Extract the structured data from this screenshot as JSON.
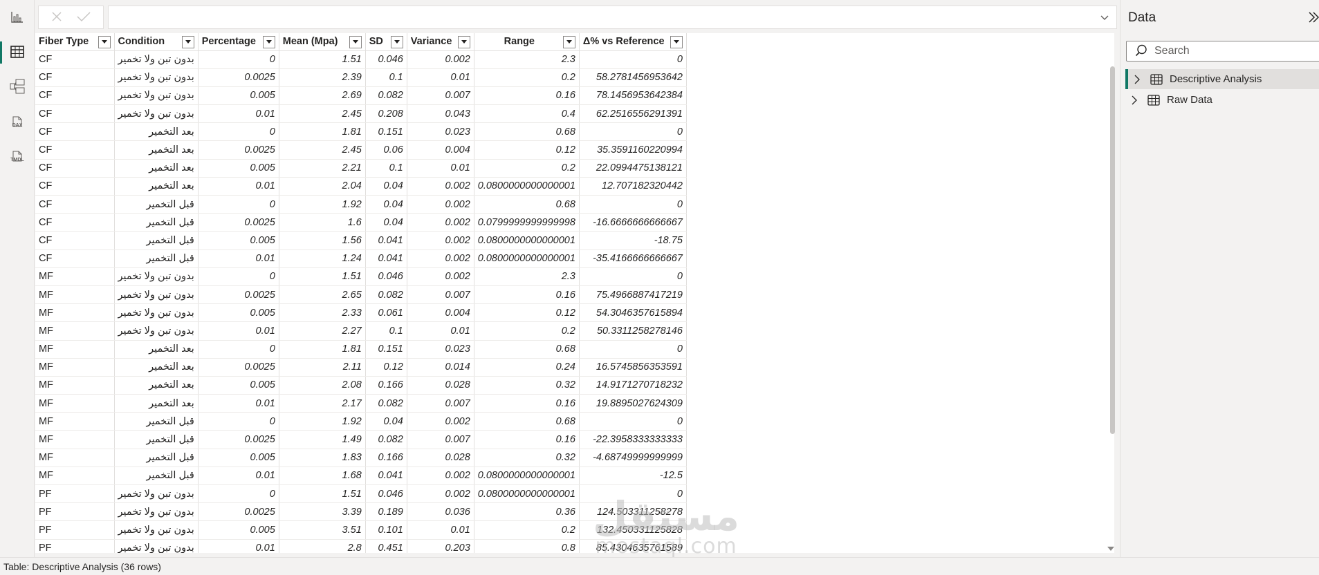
{
  "formula_bar": {
    "cancel_icon": "close-icon",
    "commit_icon": "check-icon",
    "value": "",
    "expand_icon": "chevron-down-icon"
  },
  "rail": [
    {
      "name": "report-view",
      "icon": "bar-chart-icon",
      "label": ""
    },
    {
      "name": "table-view",
      "icon": "table-icon",
      "label": "",
      "active": true
    },
    {
      "name": "model-view",
      "icon": "model-icon",
      "label": ""
    },
    {
      "name": "dax-query-view",
      "icon": "dax-icon",
      "label": "DAX"
    },
    {
      "name": "tmdl-view",
      "icon": "tmdl-icon",
      "label": "TMDL"
    }
  ],
  "table": {
    "columns": [
      "Fiber Type",
      "Condition",
      "Percentage",
      "Mean (Mpa)",
      "SD",
      "Variance",
      "Range",
      "Δ% vs Reference"
    ],
    "rows": [
      [
        "CF",
        "بدون تبن ولا تخمير",
        "0",
        "1.51",
        "0.046",
        "0.002",
        "2.3",
        "0"
      ],
      [
        "CF",
        "بدون تبن ولا تخمير",
        "0.0025",
        "2.39",
        "0.1",
        "0.01",
        "0.2",
        "58.2781456953642"
      ],
      [
        "CF",
        "بدون تبن ولا تخمير",
        "0.005",
        "2.69",
        "0.082",
        "0.007",
        "0.16",
        "78.1456953642384"
      ],
      [
        "CF",
        "بدون تبن ولا تخمير",
        "0.01",
        "2.45",
        "0.208",
        "0.043",
        "0.4",
        "62.2516556291391"
      ],
      [
        "CF",
        "بعد التخمير",
        "0",
        "1.81",
        "0.151",
        "0.023",
        "0.68",
        "0"
      ],
      [
        "CF",
        "بعد التخمير",
        "0.0025",
        "2.45",
        "0.06",
        "0.004",
        "0.12",
        "35.3591160220994"
      ],
      [
        "CF",
        "بعد التخمير",
        "0.005",
        "2.21",
        "0.1",
        "0.01",
        "0.2",
        "22.0994475138121"
      ],
      [
        "CF",
        "بعد التخمير",
        "0.01",
        "2.04",
        "0.04",
        "0.002",
        "0.0800000000000001",
        "12.707182320442"
      ],
      [
        "CF",
        "قبل التخمير",
        "0",
        "1.92",
        "0.04",
        "0.002",
        "0.68",
        "0"
      ],
      [
        "CF",
        "قبل التخمير",
        "0.0025",
        "1.6",
        "0.04",
        "0.002",
        "0.0799999999999998",
        "-16.6666666666667"
      ],
      [
        "CF",
        "قبل التخمير",
        "0.005",
        "1.56",
        "0.041",
        "0.002",
        "0.0800000000000001",
        "-18.75"
      ],
      [
        "CF",
        "قبل التخمير",
        "0.01",
        "1.24",
        "0.041",
        "0.002",
        "0.0800000000000001",
        "-35.4166666666667"
      ],
      [
        "MF",
        "بدون تبن ولا تخمير",
        "0",
        "1.51",
        "0.046",
        "0.002",
        "2.3",
        "0"
      ],
      [
        "MF",
        "بدون تبن ولا تخمير",
        "0.0025",
        "2.65",
        "0.082",
        "0.007",
        "0.16",
        "75.4966887417219"
      ],
      [
        "MF",
        "بدون تبن ولا تخمير",
        "0.005",
        "2.33",
        "0.061",
        "0.004",
        "0.12",
        "54.3046357615894"
      ],
      [
        "MF",
        "بدون تبن ولا تخمير",
        "0.01",
        "2.27",
        "0.1",
        "0.01",
        "0.2",
        "50.3311258278146"
      ],
      [
        "MF",
        "بعد التخمير",
        "0",
        "1.81",
        "0.151",
        "0.023",
        "0.68",
        "0"
      ],
      [
        "MF",
        "بعد التخمير",
        "0.0025",
        "2.11",
        "0.12",
        "0.014",
        "0.24",
        "16.5745856353591"
      ],
      [
        "MF",
        "بعد التخمير",
        "0.005",
        "2.08",
        "0.166",
        "0.028",
        "0.32",
        "14.9171270718232"
      ],
      [
        "MF",
        "بعد التخمير",
        "0.01",
        "2.17",
        "0.082",
        "0.007",
        "0.16",
        "19.8895027624309"
      ],
      [
        "MF",
        "قبل التخمير",
        "0",
        "1.92",
        "0.04",
        "0.002",
        "0.68",
        "0"
      ],
      [
        "MF",
        "قبل التخمير",
        "0.0025",
        "1.49",
        "0.082",
        "0.007",
        "0.16",
        "-22.3958333333333"
      ],
      [
        "MF",
        "قبل التخمير",
        "0.005",
        "1.83",
        "0.166",
        "0.028",
        "0.32",
        "-4.68749999999999"
      ],
      [
        "MF",
        "قبل التخمير",
        "0.01",
        "1.68",
        "0.041",
        "0.002",
        "0.0800000000000001",
        "-12.5"
      ],
      [
        "PF",
        "بدون تبن ولا تخمير",
        "0",
        "1.51",
        "0.046",
        "0.002",
        "0.0800000000000001",
        "0"
      ],
      [
        "PF",
        "بدون تبن ولا تخمير",
        "0.0025",
        "3.39",
        "0.189",
        "0.036",
        "0.36",
        "124.503311258278"
      ],
      [
        "PF",
        "بدون تبن ولا تخمير",
        "0.005",
        "3.51",
        "0.101",
        "0.01",
        "0.2",
        "132.450331125828"
      ],
      [
        "PF",
        "بدون تبن ولا تخمير",
        "0.01",
        "2.8",
        "0.451",
        "0.203",
        "0.8",
        "85.4304635761589"
      ]
    ]
  },
  "data_pane": {
    "title": "Data",
    "collapse_icon": "double-chevron-right-icon",
    "search_placeholder": "Search",
    "tables": [
      {
        "label": "Descriptive Analysis",
        "selected": true
      },
      {
        "label": "Raw Data",
        "selected": false
      }
    ]
  },
  "status_bar": {
    "text": "Table: Descriptive Analysis (36 rows)"
  },
  "watermark": {
    "line1": "مستقل",
    "line2": "mostaql.com"
  },
  "colors": {
    "accent": "#117865",
    "background": "#f3f2f1",
    "grid_border": "#e1dfdd"
  }
}
